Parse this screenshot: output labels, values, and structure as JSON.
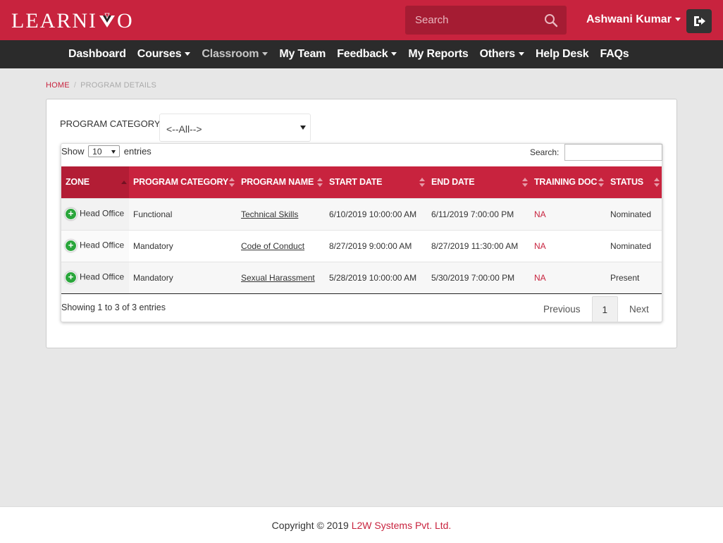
{
  "brand": {
    "logo_text_left": "LEARNI",
    "logo_text_right": "O",
    "accent_color": "#c8233e",
    "nav_bg": "#2b2b2b"
  },
  "header": {
    "search_placeholder": "Search",
    "user_name": "Ashwani Kumar"
  },
  "nav": {
    "items": [
      {
        "label": "Dashboard",
        "dropdown": false
      },
      {
        "label": "Courses",
        "dropdown": true
      },
      {
        "label": "Classroom",
        "dropdown": true,
        "active": true
      },
      {
        "label": "My Team",
        "dropdown": false
      },
      {
        "label": "Feedback",
        "dropdown": true
      },
      {
        "label": "My Reports",
        "dropdown": false
      },
      {
        "label": "Others",
        "dropdown": true
      },
      {
        "label": "Help Desk",
        "dropdown": false
      },
      {
        "label": "FAQs",
        "dropdown": false
      }
    ]
  },
  "breadcrumb": {
    "home": "HOME",
    "separator": "/",
    "current": "PROGRAM DETAILS"
  },
  "filter": {
    "label": "PROGRAM CATEGORY",
    "selected": "<--All-->"
  },
  "table": {
    "show_label": "Show",
    "page_length": "10",
    "entries_label": "entries",
    "search_label": "Search:",
    "columns": [
      "ZONE",
      "PROGRAM CATEGORY",
      "PROGRAM NAME",
      "START DATE",
      "END DATE",
      "TRAINING DOC",
      "STATUS"
    ],
    "rows": [
      {
        "zone": "Head Office",
        "category": "Functional",
        "name": "Technical Skills",
        "start": "6/10/2019 10:00:00 AM",
        "end": "6/11/2019 7:00:00 PM",
        "doc": "NA",
        "status": "Nominated"
      },
      {
        "zone": "Head Office",
        "category": "Mandatory",
        "name": "Code of Conduct",
        "start": "8/27/2019 9:00:00 AM",
        "end": "8/27/2019 11:30:00 AM",
        "doc": "NA",
        "status": "Nominated"
      },
      {
        "zone": "Head Office",
        "category": "Mandatory",
        "name": "Sexual Harassment",
        "start": "5/28/2019 10:00:00 AM",
        "end": "5/30/2019 7:00:00 PM",
        "doc": "NA",
        "status": "Present"
      }
    ],
    "info": "Showing 1 to 3 of 3 entries",
    "pagination": {
      "previous": "Previous",
      "current": "1",
      "next": "Next"
    }
  },
  "footer": {
    "copyright": "Copyright © 2019",
    "company": "L2W Systems Pvt. Ltd."
  }
}
